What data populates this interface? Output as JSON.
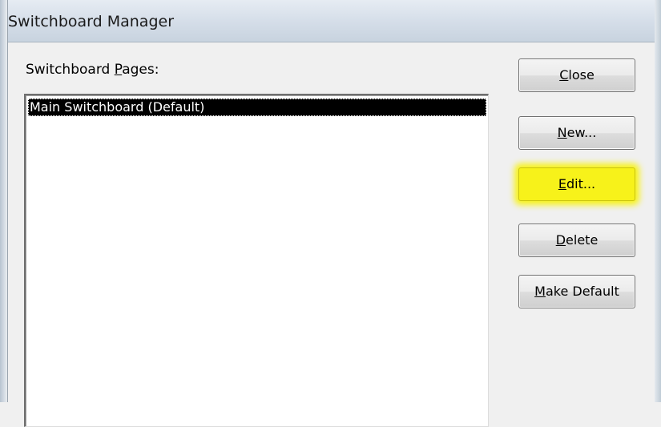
{
  "window": {
    "title": "Switchboard Manager"
  },
  "list": {
    "label_pre": "Switchboard ",
    "label_acc": "P",
    "label_post": "ages:",
    "items": [
      {
        "label": "Main Switchboard (Default)",
        "selected": true
      }
    ]
  },
  "buttons": {
    "close": {
      "acc": "C",
      "rest": "lose"
    },
    "new": {
      "acc": "N",
      "rest": "ew..."
    },
    "edit": {
      "acc": "E",
      "rest": "dit...",
      "highlight_color": "#f7f21a"
    },
    "delete": {
      "acc": "D",
      "rest": "elete"
    },
    "make_default": {
      "acc": "M",
      "rest": "ake Default"
    }
  }
}
